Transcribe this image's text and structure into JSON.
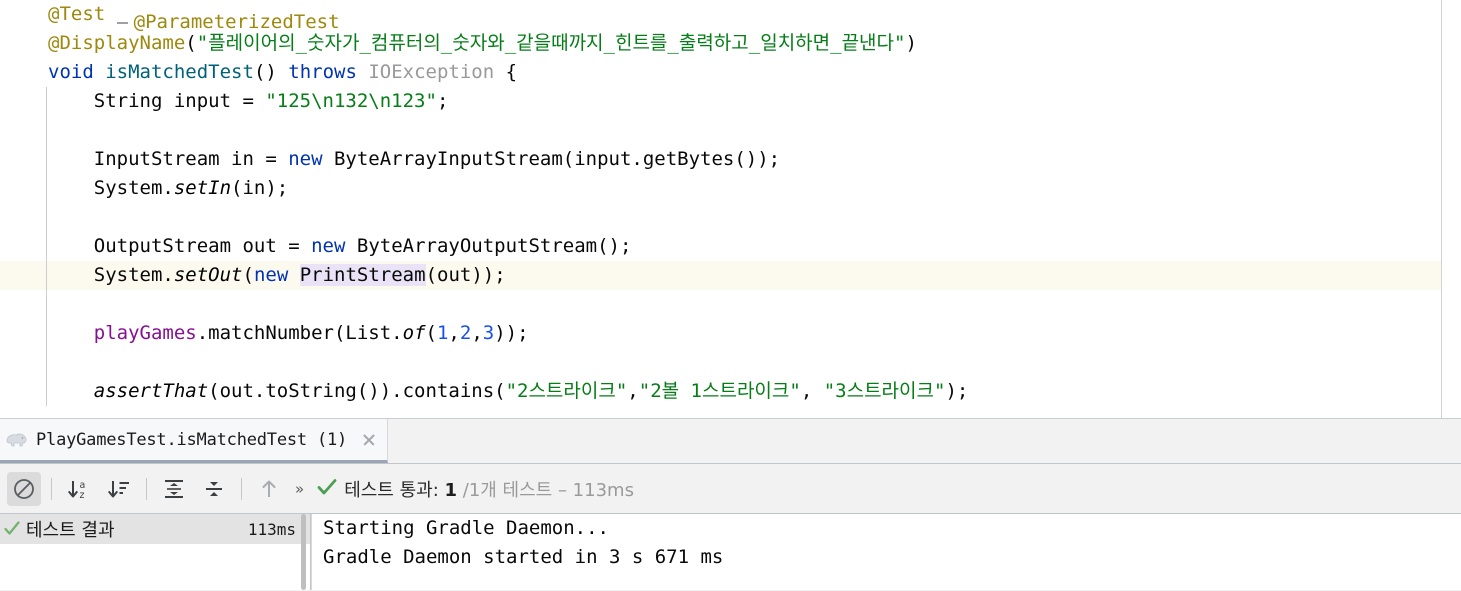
{
  "editor": {
    "clipped_top_line": "@ParameterizedTest",
    "lines": [
      {
        "id": "line-annotation-test",
        "tokens": [
          {
            "t": "@Test",
            "c": "anno"
          }
        ],
        "highlighted": false
      },
      {
        "id": "line-annotation-displayname",
        "tokens": [
          {
            "t": "@DisplayName",
            "c": "anno"
          },
          {
            "t": "(",
            "c": "plain"
          },
          {
            "t": "\"플레이어의_숫자가_컴퓨터의_숫자와_같을때까지_힌트를_출력하고_일치하면_끝낸다\"",
            "c": "str"
          },
          {
            "t": ")",
            "c": "plain"
          }
        ],
        "highlighted": false
      },
      {
        "id": "line-method-signature",
        "tokens": [
          {
            "t": "void",
            "c": "k"
          },
          {
            "t": " ",
            "c": "plain"
          },
          {
            "t": "isMatchedTest",
            "c": "mname"
          },
          {
            "t": "() ",
            "c": "plain"
          },
          {
            "t": "throws",
            "c": "k"
          },
          {
            "t": " ",
            "c": "plain"
          },
          {
            "t": "IOException",
            "c": "grey"
          },
          {
            "t": " {",
            "c": "plain"
          }
        ],
        "highlighted": false
      },
      {
        "id": "line-string-input",
        "tokens": [
          {
            "t": "    String input = ",
            "c": "plain"
          },
          {
            "t": "\"125\\n132\\n123\"",
            "c": "str"
          },
          {
            "t": ";",
            "c": "plain"
          }
        ],
        "highlighted": false
      },
      {
        "id": "line-blank-1",
        "tokens": [],
        "highlighted": false
      },
      {
        "id": "line-inputstream",
        "tokens": [
          {
            "t": "    InputStream in = ",
            "c": "plain"
          },
          {
            "t": "new",
            "c": "k"
          },
          {
            "t": " ByteArrayInputStream(input.getBytes());",
            "c": "plain"
          }
        ],
        "highlighted": false
      },
      {
        "id": "line-system-setin",
        "tokens": [
          {
            "t": "    System.",
            "c": "plain"
          },
          {
            "t": "setIn",
            "c": "fn"
          },
          {
            "t": "(in);",
            "c": "plain"
          }
        ],
        "highlighted": false
      },
      {
        "id": "line-blank-2",
        "tokens": [],
        "highlighted": false
      },
      {
        "id": "line-outputstream",
        "tokens": [
          {
            "t": "    OutputStream out = ",
            "c": "plain"
          },
          {
            "t": "new",
            "c": "k"
          },
          {
            "t": " ByteArrayOutputStream();",
            "c": "plain"
          }
        ],
        "highlighted": false
      },
      {
        "id": "line-system-setout",
        "tokens": [
          {
            "t": "    System.",
            "c": "plain"
          },
          {
            "t": "setOut",
            "c": "fn"
          },
          {
            "t": "(",
            "c": "plain"
          },
          {
            "t": "new",
            "c": "k"
          },
          {
            "t": " ",
            "c": "plain"
          },
          {
            "t": "PrintStream",
            "c": "plain hl-id"
          },
          {
            "t": "(out));",
            "c": "plain"
          }
        ],
        "highlighted": true
      },
      {
        "id": "line-blank-3",
        "tokens": [],
        "highlighted": false
      },
      {
        "id": "line-playgames-matchnumber",
        "tokens": [
          {
            "t": "    ",
            "c": "plain"
          },
          {
            "t": "playGames",
            "c": "field"
          },
          {
            "t": ".matchNumber(List.",
            "c": "plain"
          },
          {
            "t": "of",
            "c": "fn"
          },
          {
            "t": "(",
            "c": "plain"
          },
          {
            "t": "1",
            "c": "num"
          },
          {
            "t": ",",
            "c": "plain"
          },
          {
            "t": "2",
            "c": "num"
          },
          {
            "t": ",",
            "c": "plain"
          },
          {
            "t": "3",
            "c": "num"
          },
          {
            "t": "));",
            "c": "plain"
          }
        ],
        "highlighted": false
      },
      {
        "id": "line-blank-4",
        "tokens": [],
        "highlighted": false
      },
      {
        "id": "line-assertthat",
        "tokens": [
          {
            "t": "    ",
            "c": "plain"
          },
          {
            "t": "assertThat",
            "c": "fn"
          },
          {
            "t": "(out.toString()).contains(",
            "c": "plain"
          },
          {
            "t": "\"2스트라이크\"",
            "c": "str"
          },
          {
            "t": ",",
            "c": "plain"
          },
          {
            "t": "\"2볼 1스트라이크\"",
            "c": "str"
          },
          {
            "t": ", ",
            "c": "plain"
          },
          {
            "t": "\"3스트라이크\"",
            "c": "str"
          },
          {
            "t": ");",
            "c": "plain"
          }
        ],
        "highlighted": false
      }
    ]
  },
  "toolwindow": {
    "tab": {
      "icon": "gradle-elephant-icon",
      "label": "PlayGamesTest.isMatchedTest (1)",
      "close_icon": "close-icon"
    },
    "toolbar": {
      "buttons": [
        {
          "name": "rerun-failed-tests-button",
          "icon": "circle-slash-icon",
          "active": true
        },
        {
          "name": "sort-alphabetically-button",
          "icon": "sort-az-icon",
          "active": false
        },
        {
          "name": "sort-by-duration-button",
          "icon": "sort-duration-icon",
          "active": false
        },
        {
          "name": "expand-all-button",
          "icon": "expand-all-icon",
          "active": false
        },
        {
          "name": "collapse-all-button",
          "icon": "collapse-all-icon",
          "active": false
        },
        {
          "name": "previous-occurrence-button",
          "icon": "arrow-up-icon",
          "active": false
        }
      ],
      "overflow_label": "»"
    },
    "status": {
      "icon": "green-check-icon",
      "prefix": "테스트 통과: ",
      "passed_count": "1",
      "suffix": " /1개 테스트 – 113ms"
    },
    "tree": {
      "rows": [
        {
          "name": "test-result-root",
          "icon": "green-check-icon",
          "label": "테스트 결과",
          "time": "113ms"
        }
      ]
    },
    "console": {
      "lines": [
        "Starting Gradle Daemon...",
        "Gradle Daemon started in 3 s 671 ms"
      ]
    }
  },
  "colors": {
    "keyword": "#0033B3",
    "annotation": "#9E880D",
    "string": "#067D17",
    "number": "#1750EB",
    "field": "#871094",
    "method_decl": "#00627A",
    "unresolved": "#999999",
    "highlight_line": "#FCFAEF",
    "identifier_highlight": "#EAE3F8",
    "pass_green": "#59A869",
    "toolwindow_bg": "#F2F2F2",
    "tree_selection": "#E3E3E3"
  }
}
